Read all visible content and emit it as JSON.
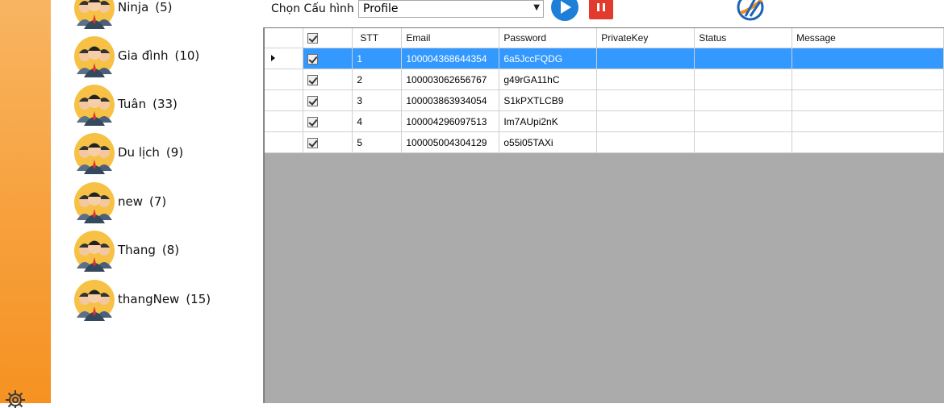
{
  "toolbar": {
    "config_label": "Chọn Cấu hình",
    "config_value": "Profile"
  },
  "groups": [
    {
      "name": "Ninja",
      "count": "(5)"
    },
    {
      "name": "Gia đình",
      "count": "(10)"
    },
    {
      "name": "Tuân",
      "count": "(33)"
    },
    {
      "name": "Du lịch",
      "count": "(9)"
    },
    {
      "name": "new",
      "count": "(7)"
    },
    {
      "name": "Thang",
      "count": "(8)"
    },
    {
      "name": "thangNew",
      "count": "(15)"
    }
  ],
  "grid": {
    "columns": [
      "STT",
      "Email",
      "Password",
      "PrivateKey",
      "Status",
      "Message"
    ],
    "rows": [
      {
        "stt": "1",
        "email": "100004368644354",
        "password": "6a5JccFQDG",
        "privatekey": "",
        "status": "",
        "message": ""
      },
      {
        "stt": "2",
        "email": "100003062656767",
        "password": "g49rGA11hC",
        "privatekey": "",
        "status": "",
        "message": ""
      },
      {
        "stt": "3",
        "email": "100003863934054",
        "password": "S1kPXTLCB9",
        "privatekey": "",
        "status": "",
        "message": ""
      },
      {
        "stt": "4",
        "email": "100004296097513",
        "password": "Im7AUpi2nK",
        "privatekey": "",
        "status": "",
        "message": ""
      },
      {
        "stt": "5",
        "email": "100005004304129",
        "password": "o55i05TAXi",
        "privatekey": "",
        "status": "",
        "message": ""
      }
    ],
    "selected_row": 0
  },
  "colors": {
    "rail": "#f7a03c",
    "selection": "#3399ff",
    "play": "#1e7fd8",
    "stop": "#e23b2e",
    "grid_empty": "#ababab"
  },
  "icons": {
    "rail": "gear-icon",
    "group": "group-avatar-icon",
    "start": "play-icon",
    "stop": "pause-icon",
    "brand": "app-logo-icon"
  }
}
